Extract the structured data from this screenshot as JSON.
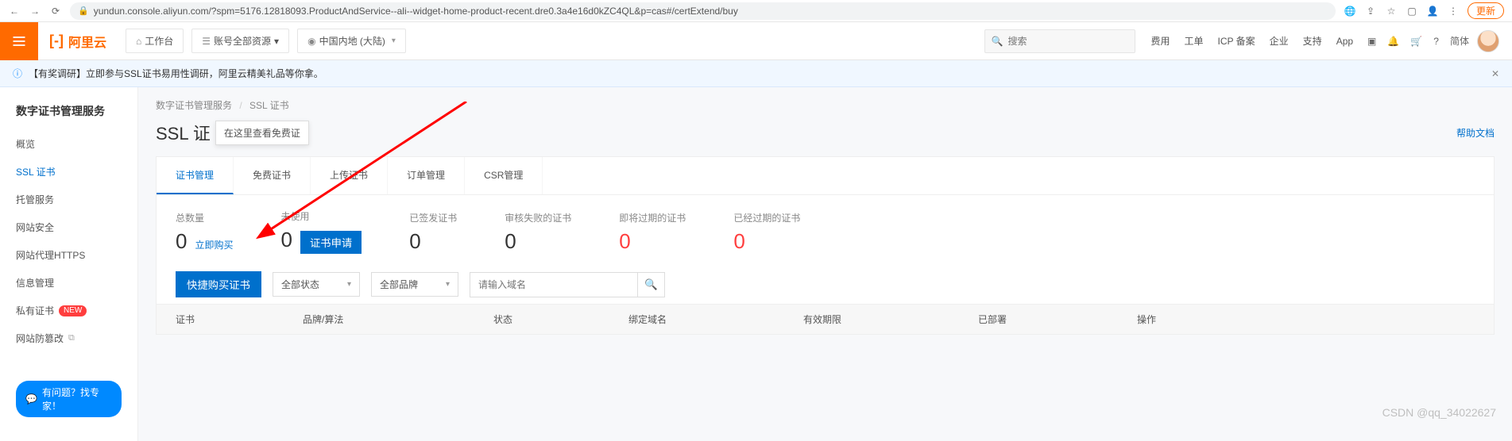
{
  "chrome": {
    "url": "yundun.console.aliyun.com/?spm=5176.12818093.ProductAndService--ali--widget-home-product-recent.dre0.3a4e16d0kZC4QL&p=cas#/certExtend/buy",
    "update_label": "更新"
  },
  "topbar": {
    "brand": "阿里云",
    "workbench": "工作台",
    "account_scope": "账号全部资源",
    "region": "中国内地 (大陆)",
    "search_placeholder": "搜索",
    "links": [
      "费用",
      "工单",
      "ICP 备案",
      "企业",
      "支持",
      "App"
    ],
    "lang": "简体"
  },
  "notice": {
    "text": "【有奖调研】立即参与SSL证书易用性调研，阿里云精美礼品等你拿。"
  },
  "sidebar": {
    "title": "数字证书管理服务",
    "items": [
      {
        "label": "概览"
      },
      {
        "label": "SSL 证书",
        "active": true
      },
      {
        "label": "托管服务"
      },
      {
        "label": "网站安全"
      },
      {
        "label": "网站代理HTTPS"
      },
      {
        "label": "信息管理"
      },
      {
        "label": "私有证书",
        "new": true
      },
      {
        "label": "网站防篡改",
        "ext": true
      }
    ],
    "help_pill": "有问题？找专家！"
  },
  "breadcrumb": {
    "a": "数字证书管理服务",
    "b": "SSL 证书"
  },
  "page": {
    "title": "SSL 证",
    "tooltip": "在这里查看免费证",
    "help_link": "帮助文档"
  },
  "tabs": [
    "证书管理",
    "免费证书",
    "上传证书",
    "订单管理",
    "CSR管理"
  ],
  "active_tab": 0,
  "stats": [
    {
      "label": "总数量",
      "value": "0",
      "action_text": "立即购买",
      "action_type": "link"
    },
    {
      "label": "未使用",
      "value": "0",
      "action_text": "证书申请",
      "action_type": "button"
    },
    {
      "label": "已签发证书",
      "value": "0"
    },
    {
      "label": "审核失败的证书",
      "value": "0"
    },
    {
      "label": "即将过期的证书",
      "value": "0",
      "red": true
    },
    {
      "label": "已经过期的证书",
      "value": "0",
      "red": true
    }
  ],
  "filters": {
    "quick_buy": "快捷购买证书",
    "status_select": "全部状态",
    "brand_select": "全部品牌",
    "domain_placeholder": "请输入域名"
  },
  "columns": [
    "证书",
    "品牌/算法",
    "状态",
    "绑定域名",
    "有效期限",
    "已部署",
    "操作"
  ],
  "watermark": "CSDN @qq_34022627"
}
